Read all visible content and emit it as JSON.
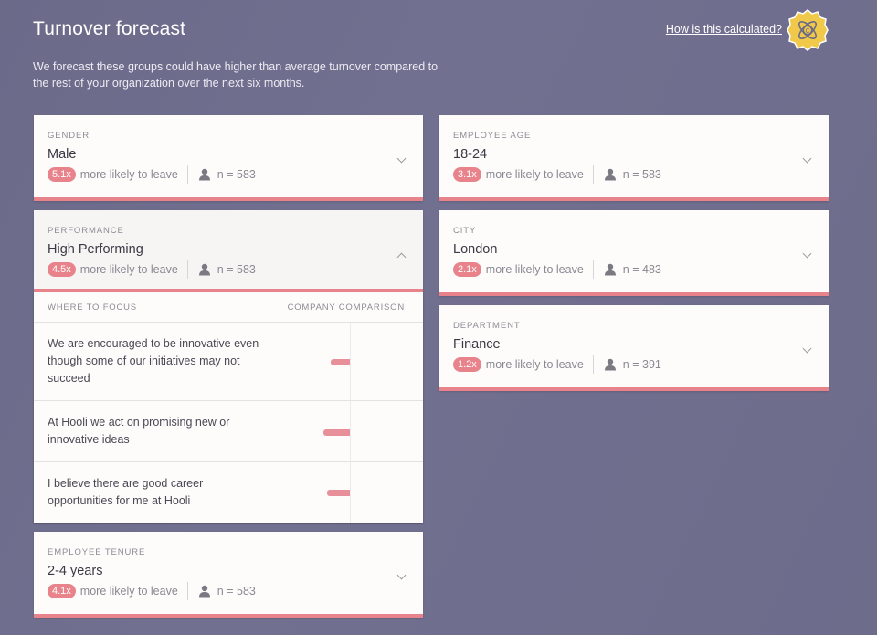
{
  "header": {
    "title": "Turnover forecast",
    "description": "We forecast these groups could have higher than average turnover compared to the rest of your organization over the next six months.",
    "help_link": "How is this calculated?",
    "logo_icon": "atom-c-badge-icon"
  },
  "colors": {
    "background": "#6f6d8c",
    "accent": "#e8838b",
    "badge_yellow": "#f0c84a"
  },
  "likely_label": "more likely to leave",
  "left_column": [
    {
      "category": "Gender",
      "value": "Male",
      "multiplier": "5.1x",
      "n": "n = 583",
      "expanded": false
    },
    {
      "category": "Performance",
      "value": "High Performing",
      "multiplier": "4.5x",
      "n": "n = 583",
      "expanded": true
    },
    {
      "category": "Employee Tenure",
      "value": "2-4 years",
      "multiplier": "4.1x",
      "n": "n = 583",
      "expanded": false
    }
  ],
  "right_column": [
    {
      "category": "Employee Age",
      "value": "18-24",
      "multiplier": "3.1x",
      "n": "n = 583",
      "expanded": false
    },
    {
      "category": "City",
      "value": "London",
      "multiplier": "2.1x",
      "n": "n = 483",
      "expanded": false
    },
    {
      "category": "Department",
      "value": "Finance",
      "multiplier": "1.2x",
      "n": "n = 391",
      "expanded": false
    }
  ],
  "focus": {
    "where_label": "WHERE TO FOCUS",
    "comparison_label": "COMPANY COMPARISON",
    "items": [
      {
        "text": "We are encouraged to be innovative even though some of our initiatives may not succeed",
        "comparison": -21
      },
      {
        "text": "At Hooli we act on promising new or innovative ideas",
        "comparison": -29
      },
      {
        "text": "I believe there are good career opportunities for me at Hooli",
        "comparison": -25
      }
    ]
  }
}
